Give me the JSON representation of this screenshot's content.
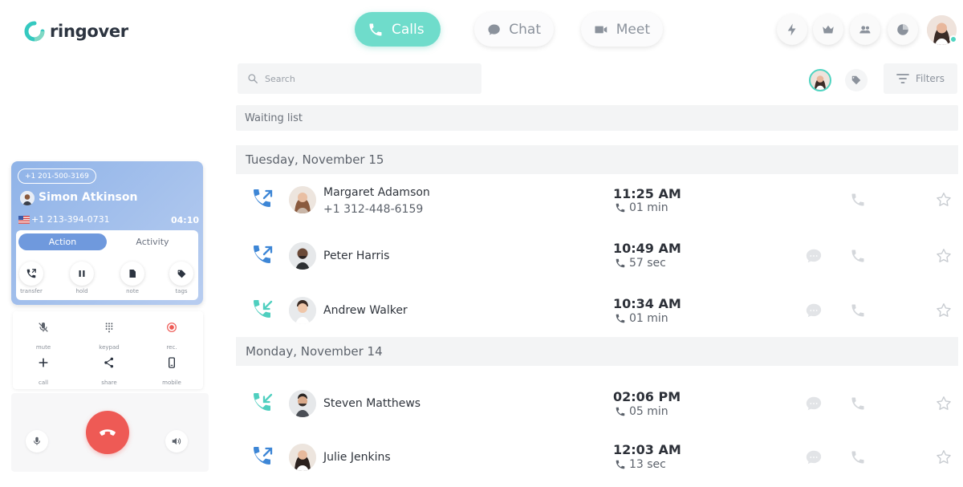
{
  "app": {
    "name": "ringover",
    "brand_color": "#35c9c0"
  },
  "nav": {
    "calls": "Calls",
    "chat": "Chat",
    "meet": "Meet"
  },
  "search": {
    "placeholder": "Search"
  },
  "toolbar": {
    "filters": "Filters"
  },
  "waiting_list": "Waiting list",
  "days": [
    {
      "label": "Tuesday, November 15",
      "calls": [
        {
          "name": "Margaret Adamson",
          "number": "+1 312-448-6159",
          "time": "11:25 AM",
          "duration": "01 min",
          "direction": "outgoing"
        },
        {
          "name": "Peter Harris",
          "number": "",
          "time": "10:49 AM",
          "duration": "57 sec",
          "direction": "outgoing"
        },
        {
          "name": "Andrew Walker",
          "number": "",
          "time": "10:34 AM",
          "duration": "01 min",
          "direction": "incoming"
        }
      ]
    },
    {
      "label": "Monday, November 14",
      "calls": [
        {
          "name": "Steven Matthews",
          "number": "",
          "time": "02:06 PM",
          "duration": "05 min",
          "direction": "incoming"
        },
        {
          "name": "Julie Jenkins",
          "number": "",
          "time": "12:03 AM",
          "duration": "13 sec",
          "direction": "outgoing"
        }
      ]
    }
  ],
  "dialer": {
    "line_number": "+1 201-500-3169",
    "contact_name": "Simon Atkinson",
    "contact_phone": "+1 213-394-0731",
    "timer": "04:10",
    "tabs": [
      "Action",
      "Activity"
    ],
    "actions": [
      "transfer",
      "hold",
      "note",
      "tags"
    ],
    "keypad": [
      "mute",
      "keypad",
      "rec.",
      "call",
      "share",
      "mobile"
    ]
  },
  "colors": {
    "outgoing": "#3d86d6",
    "incoming": "#4fcfbf",
    "hangup": "#ee5a55"
  }
}
